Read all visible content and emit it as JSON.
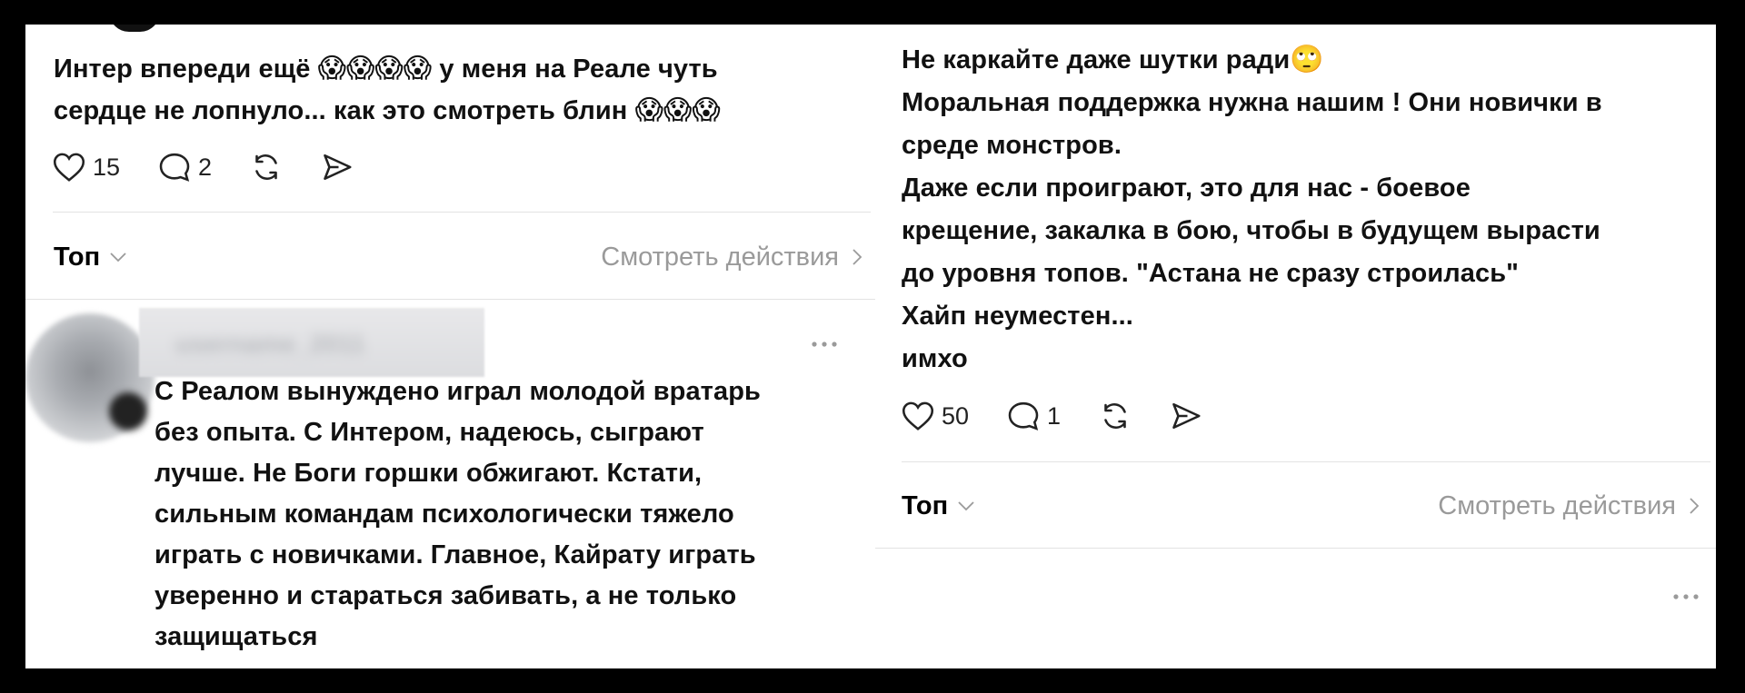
{
  "left": {
    "post": {
      "text_before": "Интер впереди ещё ",
      "emoji_group_1": "😱😱😱😱",
      "text_after": " у меня на Реале чуть",
      "line2_text": "сердце не лопнуло... как это смотреть блин ",
      "emoji_group_2": "😱😱😱",
      "likes": "15",
      "comments": "2"
    },
    "sort": {
      "label": "Топ",
      "view_actions": "Смотреть действия"
    },
    "reply": {
      "username": "username_2011",
      "lines": [
        "С Реалом вынуждено играл молодой вратарь",
        "без опыта. С Интером, надеюсь, сыграют",
        "лучше. Не Боги горшки обжигают. Кстати,",
        "сильным командам психологически тяжело",
        "играть с новичками. Главное, Кайрату играть",
        "уверенно и стараться забивать, а не только",
        "защищаться"
      ]
    }
  },
  "right": {
    "post": {
      "line1": "Не каркайте даже шутки ради",
      "line1_emoji": "🙄",
      "lines": [
        "Моральная поддержка нужна нашим ! Они новички в",
        "среде монстров.",
        "Даже если проиграют, это для нас - боевое",
        "крещение, закалка в бою, чтобы в будущем вырасти",
        "до уровня топов. \"Астана не сразу строилась\"",
        "Хайп неуместен...",
        "имхо"
      ],
      "likes": "50",
      "comments": "1"
    },
    "sort": {
      "label": "Топ",
      "view_actions": "Смотреть действия"
    }
  },
  "colors": {
    "text": "#111111",
    "muted": "#9a9a9a",
    "divider": "#e3e3e3",
    "frame": "#000000"
  }
}
